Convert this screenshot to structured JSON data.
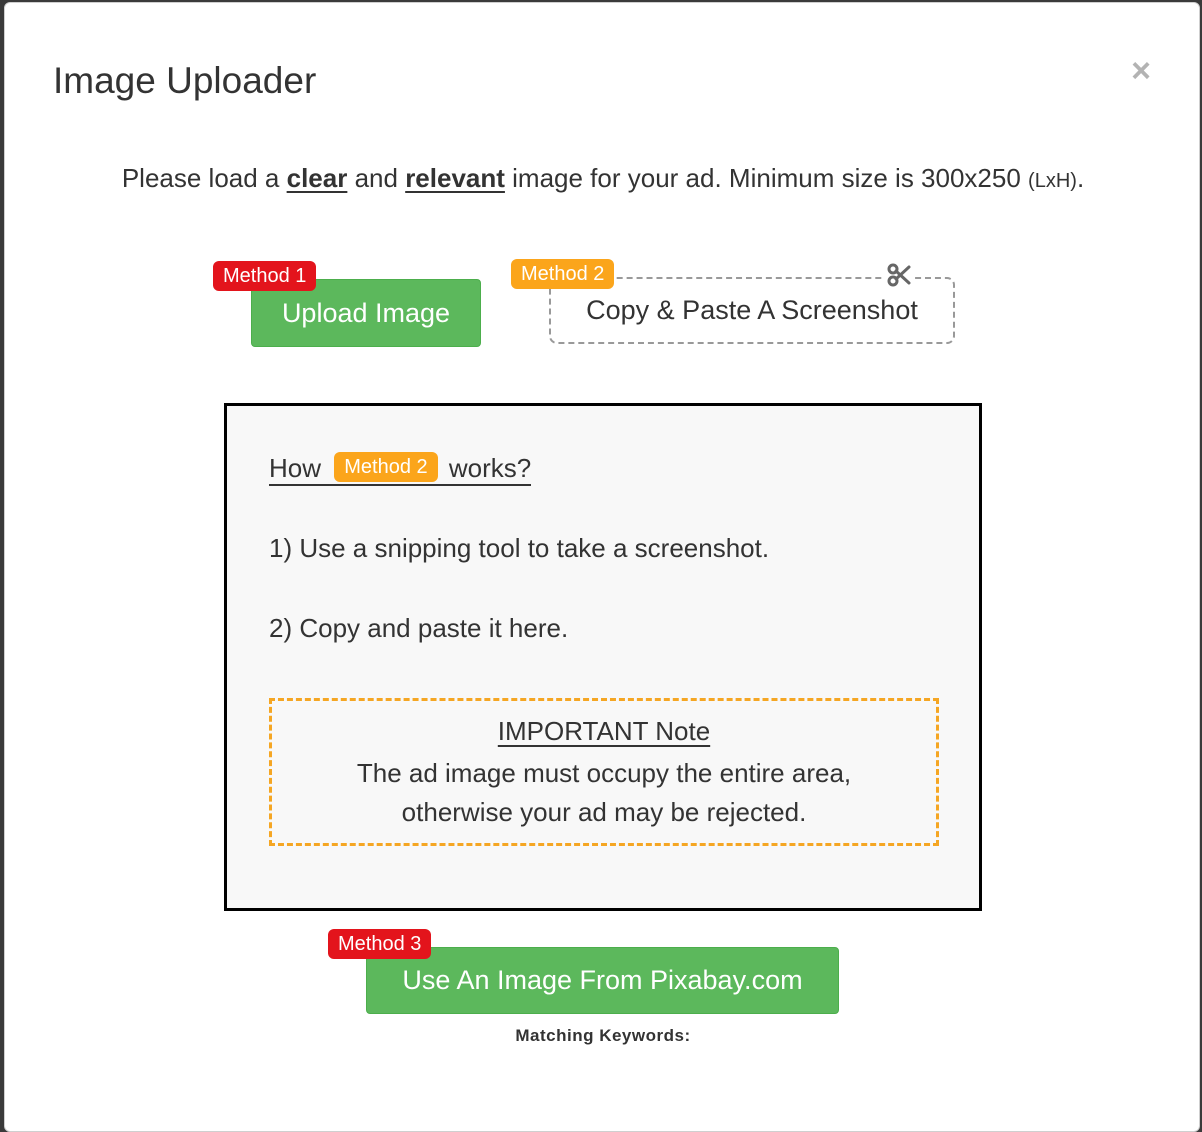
{
  "modal": {
    "title": "Image Uploader",
    "close_label": "×"
  },
  "intro": {
    "prefix": "Please load a ",
    "clear": "clear",
    "and": " and ",
    "relevant": "relevant",
    "suffix": " image for your ad. Minimum size is 300x250 ",
    "dimension_hint": "(LxH)",
    "end": "."
  },
  "methods": {
    "method1_badge": "Method 1",
    "method2_badge": "Method 2",
    "method3_badge": "Method 3",
    "upload_button": "Upload Image",
    "paste_button": "Copy & Paste A Screenshot",
    "pixabay_button": "Use An Image From Pixabay.com"
  },
  "paste_area": {
    "how_prefix": "How ",
    "how_badge": "Method 2",
    "how_suffix": " works?",
    "step1": "1) Use a snipping tool to take a screenshot.",
    "step2": "2) Copy and paste it here.",
    "note_title": "IMPORTANT Note",
    "note_line1": "The ad image must occupy the entire area,",
    "note_line2": "otherwise your ad may be rejected."
  },
  "keywords": {
    "label": "Matching Keywords:"
  },
  "icons": {
    "close": "close-icon",
    "scissors": "scissors-icon"
  },
  "colors": {
    "green_button": "#5cb85c",
    "red_badge": "#e3141c",
    "orange_badge": "#fba51b",
    "note_border": "#f5a623"
  }
}
